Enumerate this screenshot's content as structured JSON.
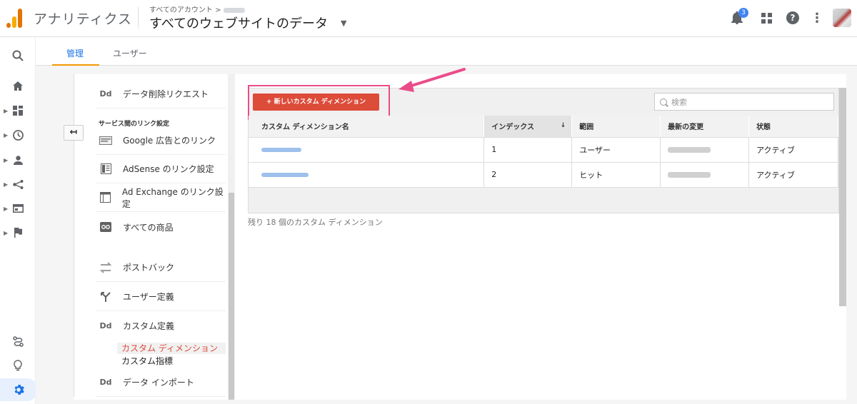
{
  "header": {
    "app_name": "アナリティクス",
    "breadcrumb": "すべてのアカウント >",
    "property_title": "すべてのウェブサイトのデータ",
    "notification_count": "3"
  },
  "tabs": [
    {
      "label": "管理",
      "active": true
    },
    {
      "label": "ユーザー",
      "active": false
    }
  ],
  "rail": [
    "search-icon",
    "home-icon",
    "dashboard-icon",
    "clock-icon",
    "person-icon",
    "acquisition-icon",
    "behavior-icon",
    "flag-icon",
    "attribution-icon",
    "lightbulb-icon",
    "gear-icon"
  ],
  "admin_nav": {
    "data_deletion": "データ削除リクエスト",
    "section_title": "サービス間のリンク設定",
    "google_ads": "Google 広告とのリンク",
    "adsense": "AdSense のリンク設定",
    "ad_exchange": "Ad Exchange のリンク設定",
    "all_products": "すべての商品",
    "postback": "ポストバック",
    "user_definitions": "ユーザー定義",
    "custom_definitions": "カスタム定義",
    "sub_custom_dimensions": "カスタム ディメンション",
    "sub_custom_metrics": "カスタム指標",
    "data_import": "データ インポート",
    "dd_label": "Dd"
  },
  "main": {
    "new_button": "+ 新しいカスタム ディメンション",
    "search_placeholder": "検索",
    "columns": [
      "カスタム ディメンション名",
      "インデックス",
      "範囲",
      "最新の変更",
      "状態"
    ],
    "rows": [
      {
        "index": "1",
        "scope": "ユーザー",
        "status": "アクティブ"
      },
      {
        "index": "2",
        "scope": "ヒット",
        "status": "アクティブ"
      }
    ],
    "remaining": "残り 18 個のカスタム ディメンション"
  },
  "colors": {
    "accent": "#1a73e8",
    "button_red": "#dd4b39",
    "highlight_pink": "#ea4c89",
    "tab_underline": "#f29900"
  }
}
